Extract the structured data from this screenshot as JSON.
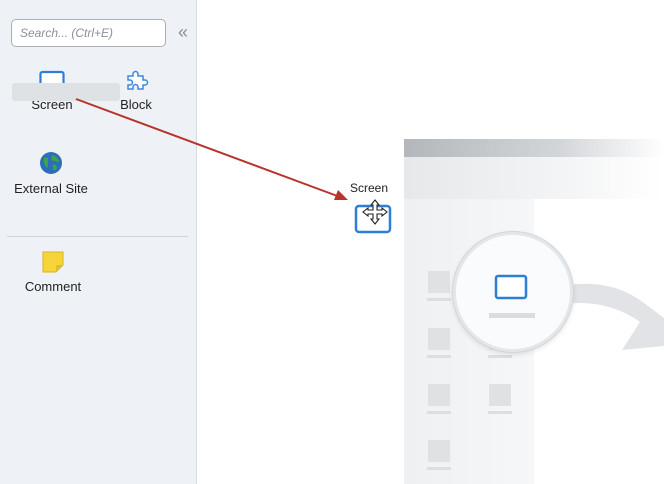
{
  "sidebar": {
    "search": {
      "placeholder": "Search... (Ctrl+E)"
    },
    "collapse_icon": "double-chevron-left-icon",
    "items": [
      {
        "label": "Screen",
        "icon": "screen-icon"
      },
      {
        "label": "Block",
        "icon": "block-puzzle-icon"
      },
      {
        "label": "External Site",
        "icon": "globe-icon"
      },
      {
        "label": "Comment",
        "icon": "sticky-note-icon"
      }
    ]
  },
  "drag": {
    "label": "Screen",
    "icon": "screen-icon",
    "cursor": "move-cursor-icon"
  },
  "colors": {
    "arrow": "#b8342a",
    "screen_icon": "#2f7ed6",
    "sidebar_bg": "#eef2f6",
    "sticky_note": "#f6d43a"
  }
}
